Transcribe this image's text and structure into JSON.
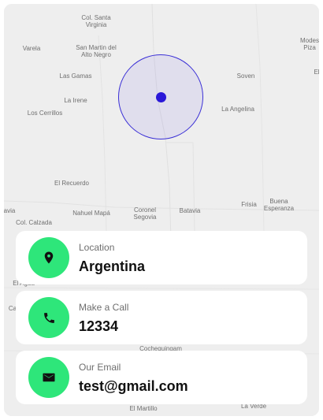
{
  "map": {
    "places": [
      {
        "id": "col-santa-virginia",
        "label": "Col. Santa\nVirginia"
      },
      {
        "id": "varela",
        "label": "Varela"
      },
      {
        "id": "san-martin",
        "label": "San Martin del\nAlto Negro"
      },
      {
        "id": "las-gamas",
        "label": "Las Gamas"
      },
      {
        "id": "la-irene",
        "label": "La Irene"
      },
      {
        "id": "los-cerrillos",
        "label": "Los Cerrillos"
      },
      {
        "id": "soven",
        "label": "Soven"
      },
      {
        "id": "la-angelina",
        "label": "La Angelina"
      },
      {
        "id": "el-recuerdo",
        "label": "El Recuerdo"
      },
      {
        "id": "avia",
        "label": "avia"
      },
      {
        "id": "nahuel-mapa",
        "label": "Nahuel Mapá"
      },
      {
        "id": "coronel-segovia",
        "label": "Coronel\nSegovia"
      },
      {
        "id": "batavia",
        "label": "Batavia"
      },
      {
        "id": "frisia",
        "label": "Frisia"
      },
      {
        "id": "buena-esperanza",
        "label": "Buena\nEsperanza"
      },
      {
        "id": "col-calzada",
        "label": "Col. Calzada"
      },
      {
        "id": "modes-piza",
        "label": "Modes\nPiza"
      },
      {
        "id": "el-top-right",
        "label": "El"
      },
      {
        "id": "el-agua",
        "label": "El Agua"
      },
      {
        "id": "ca",
        "label": "Ca"
      },
      {
        "id": "cochequingam",
        "label": "Cochequingam"
      },
      {
        "id": "el-martillo",
        "label": "El Martillo"
      },
      {
        "id": "la-verde",
        "label": "La Verde"
      }
    ],
    "marker_color": "#2a17d8",
    "radius_color": "#3a2fd6"
  },
  "contacts": [
    {
      "label": "Location",
      "value": "Argentina",
      "icon": "location-pin-icon"
    },
    {
      "label": "Make a Call",
      "value": "12334",
      "icon": "phone-icon"
    },
    {
      "label": "Our Email",
      "value": "test@gmail.com",
      "icon": "mail-icon"
    }
  ],
  "colors": {
    "icon_bg": "#2ee67a",
    "card_bg": "#ffffff",
    "map_bg": "#eeeeee"
  }
}
